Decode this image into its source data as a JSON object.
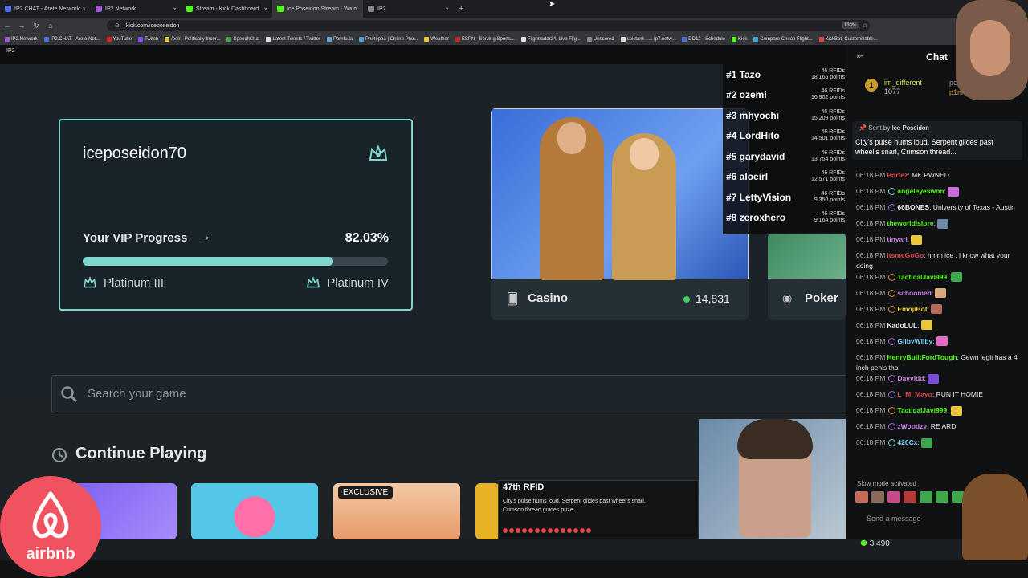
{
  "browser": {
    "tabs": [
      {
        "label": "IP2.CHAT - Arete Network",
        "color": "#4b6fe0",
        "active": false
      },
      {
        "label": "IP2.Network",
        "color": "#a05ad8",
        "active": false
      },
      {
        "label": "Stream - Kick Dashboard",
        "color": "#53fc18",
        "active": false
      },
      {
        "label": "Ice Poseidon Stream - Watc",
        "color": "#53fc18",
        "active": true
      },
      {
        "label": "IP2",
        "color": "#888888",
        "active": false
      }
    ],
    "new_tab": "+",
    "url": "kick.com/iceposeidon",
    "zoom": "133%",
    "bookmarks": [
      "IP2.Network",
      "IP2.CHAT - Arete Net...",
      "YouTube",
      "Twitch",
      "/pol/ - Politically Incor...",
      "SpeechChat",
      "Latest Tweets / Twitter",
      "Pornfu.la",
      "Photopea | Online Pho...",
      "Weather",
      "ESPN - Serving Sports...",
      "Flightradar24: Live Flig...",
      "Unscored",
      "spictank ..... ip7.netw...",
      "DD12 - Schedule",
      "Kick",
      "Compare Cheap Flight...",
      "KickBot: Customizable..."
    ]
  },
  "site": {
    "logo": "IP2"
  },
  "vip": {
    "username": "iceposeidon70",
    "progress_label": "Your VIP Progress",
    "progress_arrow": "→",
    "percent": "82.03%",
    "fill_fraction": 0.8203,
    "current_tier": "Platinum III",
    "next_tier": "Platinum IV"
  },
  "casino": {
    "name": "Casino",
    "online": "14,831"
  },
  "poker": {
    "name": "Poker"
  },
  "leaderboard": [
    {
      "rank": "#1 Tazo",
      "rfids": "46 RFIDs",
      "points": "18,165 points"
    },
    {
      "rank": "#2 ozemi",
      "rfids": "46 RFIDs",
      "points": "16,902 points"
    },
    {
      "rank": "#3 mhyochi",
      "rfids": "46 RFIDs",
      "points": "15,209 points"
    },
    {
      "rank": "#4 LordHito",
      "rfids": "46 RFIDs",
      "points": "14,501 points"
    },
    {
      "rank": "#5 garydavid",
      "rfids": "46 RFIDs",
      "points": "13,754 points"
    },
    {
      "rank": "#6 aloeirl",
      "rfids": "46 RFIDs",
      "points": "12,571 points"
    },
    {
      "rank": "#7 LettyVision",
      "rfids": "46 RFIDs",
      "points": "9,350 points"
    },
    {
      "rank": "#8 zeroxhero",
      "rfids": "46 RFIDs",
      "points": "9,164 points"
    }
  ],
  "search": {
    "placeholder": "Search your game"
  },
  "continue": {
    "title": "Continue Playing",
    "exclusive_tag": "EXCLUSIVE"
  },
  "notification": {
    "title": "47th RFID",
    "body": "City's pulse hums loud, Serpent glides past wheel's snarl, Crimson thread guides prize."
  },
  "chat": {
    "title": "Chat",
    "gift_rank": "1",
    "gift_user": "im_different",
    "gift_count": "1077",
    "gift_user2": "pepp",
    "gift_user3": "p1nk_panther",
    "pinned_sent_by": "Sent by",
    "pinned_user": "Ice Poseidon",
    "pinned_msg": "City's pulse hums loud, Serpent glides past wheel's snarl, Crimson thread...",
    "messages": [
      {
        "time": "06:18 PM",
        "user": "Portez",
        "color": "#e04848",
        "badge": "",
        "text": ": MK PWNED"
      },
      {
        "time": "06:18 PM",
        "user": "angeleyeswon",
        "color": "#53fc18",
        "badge": "#7fd6cc",
        "text": ":"
      },
      {
        "time": "06:18 PM",
        "user": "66BONES",
        "color": "#e8e8e8",
        "badge": "#9a6ad8",
        "text": ": University of Texas - Austin"
      },
      {
        "time": "06:18 PM",
        "user": "theworldislore",
        "color": "#53fc18",
        "badge": "",
        "text": ":"
      },
      {
        "time": "06:18 PM",
        "user": "tinyari",
        "color": "#c87de8",
        "badge": "",
        "text": ":"
      },
      {
        "time": "06:18 PM",
        "user": "ItsmeGoGo",
        "color": "#e04848",
        "badge": "",
        "text": ": hmm ice , i know what your doing"
      },
      {
        "time": "06:18 PM",
        "user": "TacticalJavi999",
        "color": "#53fc18",
        "badge": "#d48a3a",
        "text": ":"
      },
      {
        "time": "06:18 PM",
        "user": "schoomed",
        "color": "#c87de8",
        "badge": "#d48a3a",
        "text": ":"
      },
      {
        "time": "06:18 PM",
        "user": "EmojiBot",
        "color": "#e8c83a",
        "badge": "#d48a3a",
        "text": ":"
      },
      {
        "time": "06:18 PM",
        "user": "KadoLUL",
        "color": "#e8e8e8",
        "badge": "",
        "text": ":"
      },
      {
        "time": "06:18 PM",
        "user": "GilbyWilby",
        "color": "#7fd6ff",
        "badge": "#9a6ad8",
        "text": ":"
      },
      {
        "time": "06:18 PM",
        "user": "HenryBuiltFordTough",
        "color": "#53fc18",
        "badge": "",
        "text": ": Gewn legit has a 4 inch penis tho"
      },
      {
        "time": "06:18 PM",
        "user": "Davvidd",
        "color": "#c87de8",
        "badge": "#9a6ad8",
        "text": ":"
      },
      {
        "time": "06:18 PM",
        "user": "L_M_Mayo",
        "color": "#e04848",
        "badge": "#9a6ad8",
        "text": ": RUN IT HOMIE"
      },
      {
        "time": "06:18 PM",
        "user": "TacticalJavi999",
        "color": "#53fc18",
        "badge": "#d48a3a",
        "text": ":"
      },
      {
        "time": "06:18 PM",
        "user": "zWoodzy",
        "color": "#c87de8",
        "badge": "#9a6ad8",
        "text": ": RE ARD"
      },
      {
        "time": "06:18 PM",
        "user": "420Cx",
        "color": "#7fd6ff",
        "badge": "#7fd6cc",
        "text": ":"
      }
    ],
    "slow_mode": "Slow mode activated",
    "send_placeholder": "Send a message",
    "viewers": "3,490"
  },
  "overlay": {
    "brand": "airbnb"
  },
  "colors": {
    "accent": "#7fd6cc",
    "kick_green": "#53fc18",
    "online": "#3fcf5a"
  }
}
